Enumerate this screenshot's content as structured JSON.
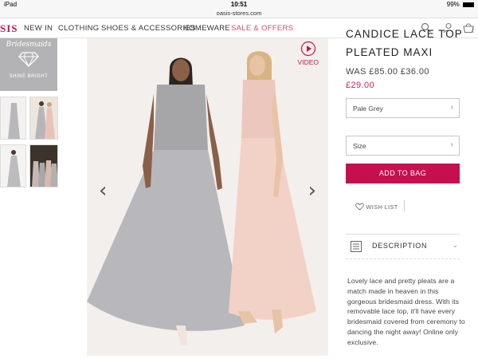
{
  "status_bar": {
    "device": "iPad",
    "time": "10:51",
    "battery": "99%"
  },
  "browser": {
    "url": "oasis-stores.com"
  },
  "nav": {
    "logo": "SIS",
    "items": [
      "NEW IN",
      "CLOTHING",
      "SHOES & ACCESSORIES",
      "HOMEWARE",
      "SALE & OFFERS"
    ],
    "sale_color": "#d8486f",
    "icons": [
      "search-icon",
      "account-icon",
      "basket-icon"
    ]
  },
  "badge": {
    "script": "Bridesmaids",
    "sub": "SHINE BRIGHT"
  },
  "media": {
    "video_label": "VIDEO"
  },
  "product": {
    "title_line1": "CANDICE LACE TOP",
    "title_line2": "PLEATED MAXI",
    "was_price": "WAS £85.00 £36.00",
    "price": "£29.00",
    "colour_value": "Pale Grey",
    "size_placeholder": "Size",
    "add_to_bag": "ADD TO BAG",
    "wish_list": "WISH LIST",
    "description_label": "DESCRIPTION",
    "description": "Lovely lace and pretty pleats are a match made in heaven in this gorgeous bridesmaid dress. With its removable lace top, it'll have every bridesmaid covered from ceremony to dancing the night away! Online only exclusive.",
    "accent_color": "#c70f4f"
  }
}
